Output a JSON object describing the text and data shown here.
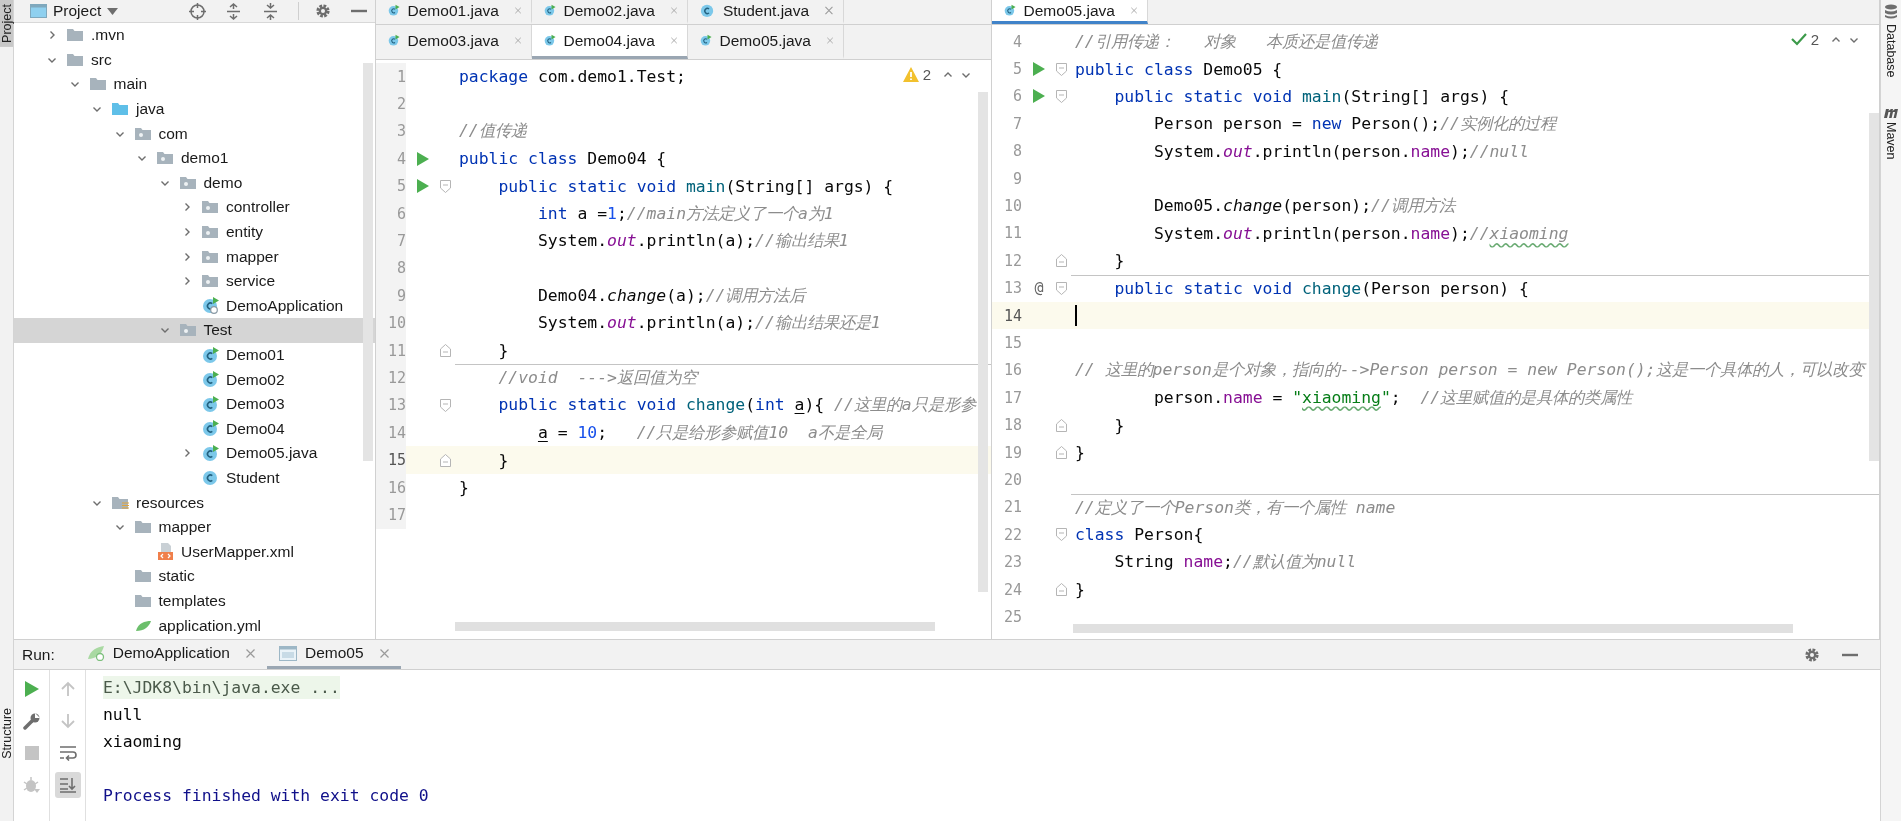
{
  "side_bar_left": {
    "top": [
      {
        "label": "Project",
        "selected": true
      }
    ],
    "bottom": [
      {
        "label": "Structure",
        "selected": false
      }
    ]
  },
  "project_panel": {
    "title": "Project",
    "tree": [
      {
        "label": ".mvn",
        "kind": "folder",
        "expanded": false,
        "selected": false
      },
      {
        "label": "src",
        "kind": "folder",
        "expanded": true,
        "selected": false,
        "children": [
          {
            "label": "main",
            "kind": "folder",
            "expanded": true,
            "selected": false,
            "children": [
              {
                "label": "java",
                "kind": "source-folder",
                "expanded": true,
                "selected": false,
                "children": [
                  {
                    "label": "com",
                    "kind": "package",
                    "expanded": true,
                    "selected": false,
                    "children": [
                      {
                        "label": "demo1",
                        "kind": "package",
                        "expanded": true,
                        "selected": false,
                        "children": [
                          {
                            "label": "demo",
                            "kind": "package",
                            "expanded": true,
                            "selected": false,
                            "children": [
                              {
                                "label": "controller",
                                "kind": "package",
                                "expanded": false,
                                "selected": false
                              },
                              {
                                "label": "entity",
                                "kind": "package",
                                "expanded": false,
                                "selected": false
                              },
                              {
                                "label": "mapper",
                                "kind": "package",
                                "expanded": false,
                                "selected": false
                              },
                              {
                                "label": "service",
                                "kind": "package",
                                "expanded": false,
                                "selected": false
                              },
                              {
                                "label": "DemoApplication",
                                "kind": "spring-class",
                                "selected": false
                              }
                            ]
                          },
                          {
                            "label": "Test",
                            "kind": "package",
                            "expanded": true,
                            "selected": true,
                            "children": [
                              {
                                "label": "Demo01",
                                "kind": "class-runnable",
                                "selected": false
                              },
                              {
                                "label": "Demo02",
                                "kind": "class-runnable",
                                "selected": false
                              },
                              {
                                "label": "Demo03",
                                "kind": "class-runnable",
                                "selected": false
                              },
                              {
                                "label": "Demo04",
                                "kind": "class-runnable",
                                "selected": false
                              },
                              {
                                "label": "Demo05.java",
                                "kind": "class-runnable",
                                "expanded": false,
                                "selected": false
                              },
                              {
                                "label": "Student",
                                "kind": "class",
                                "selected": false
                              }
                            ]
                          }
                        ]
                      }
                    ]
                  }
                ]
              },
              {
                "label": "resources",
                "kind": "resources-folder",
                "expanded": true,
                "selected": false,
                "children": [
                  {
                    "label": "mapper",
                    "kind": "folder",
                    "expanded": true,
                    "selected": false,
                    "children": [
                      {
                        "label": "UserMapper.xml",
                        "kind": "xml-file",
                        "selected": false
                      }
                    ]
                  },
                  {
                    "label": "static",
                    "kind": "folder",
                    "selected": false
                  },
                  {
                    "label": "templates",
                    "kind": "folder",
                    "selected": false
                  },
                  {
                    "label": "application.yml",
                    "kind": "yml-file",
                    "selected": false
                  }
                ]
              }
            ]
          }
        ]
      }
    ]
  },
  "left_editor": {
    "focused": false,
    "inspection": {
      "kind": "warning",
      "count": "2"
    },
    "tab_rows": [
      [
        {
          "label": "Demo01.java",
          "kind": "class-runnable",
          "selected": false
        },
        {
          "label": "Demo02.java",
          "kind": "class-runnable",
          "selected": false
        },
        {
          "label": "Student.java",
          "kind": "class",
          "selected": false
        }
      ],
      [
        {
          "label": "Demo03.java",
          "kind": "class-runnable",
          "selected": false
        },
        {
          "label": "Demo04.java",
          "kind": "class-runnable",
          "selected": true
        },
        {
          "label": "Demo05.java",
          "kind": "class-runnable",
          "selected": false
        }
      ]
    ],
    "lines": [
      {
        "number": "1",
        "current": false,
        "tokens": [
          {
            "kind": "keyword",
            "text": "package"
          },
          {
            "kind": "plain",
            "text": " com.demo1.Test;"
          }
        ]
      },
      {
        "number": "2",
        "current": false
      },
      {
        "number": "3",
        "current": false,
        "tokens": [
          {
            "kind": "comment",
            "text": "//值传递"
          }
        ]
      },
      {
        "number": "4",
        "current": false,
        "runnable": true,
        "tokens": [
          {
            "kind": "keyword",
            "text": "public class "
          },
          {
            "kind": "plain",
            "text": "Demo04 {"
          }
        ]
      },
      {
        "number": "5",
        "current": false,
        "runnable": true,
        "fold_start": true,
        "tokens": [
          {
            "kind": "keyword",
            "text": "    public static void "
          },
          {
            "kind": "decl",
            "text": "main"
          },
          {
            "kind": "plain",
            "text": "(String[] args) {"
          }
        ]
      },
      {
        "number": "6",
        "current": false,
        "tokens": [
          {
            "kind": "keyword",
            "text": "        int"
          },
          {
            "kind": "plain",
            "text": " a ="
          },
          {
            "kind": "number",
            "text": "1"
          },
          {
            "kind": "plain",
            "text": ";"
          },
          {
            "kind": "comment",
            "text": "//main方法定义了一个a为1"
          }
        ]
      },
      {
        "number": "7",
        "current": false,
        "tokens": [
          {
            "kind": "plain",
            "text": "        System."
          },
          {
            "kind": "static-field",
            "text": "out"
          },
          {
            "kind": "plain",
            "text": ".println(a);"
          },
          {
            "kind": "comment",
            "text": "//输出结果1"
          }
        ]
      },
      {
        "number": "8",
        "current": false
      },
      {
        "number": "9",
        "current": false,
        "tokens": [
          {
            "kind": "plain",
            "text": "        Demo04."
          },
          {
            "kind": "static-call",
            "text": "change"
          },
          {
            "kind": "plain",
            "text": "(a);"
          },
          {
            "kind": "comment",
            "text": "//调用方法后"
          }
        ]
      },
      {
        "number": "10",
        "current": false,
        "tokens": [
          {
            "kind": "plain",
            "text": "        System."
          },
          {
            "kind": "static-field",
            "text": "out"
          },
          {
            "kind": "plain",
            "text": ".println(a);"
          },
          {
            "kind": "comment",
            "text": "//输出结果还是1"
          }
        ]
      },
      {
        "number": "11",
        "current": false,
        "fold_end": true,
        "tokens": [
          {
            "kind": "plain",
            "text": "    }"
          }
        ]
      },
      {
        "number": "12",
        "current": false,
        "separator": true,
        "tokens": [
          {
            "kind": "comment",
            "text": "    //void  --->返回值为空"
          }
        ]
      },
      {
        "number": "13",
        "current": false,
        "fold_start": true,
        "tokens": [
          {
            "kind": "keyword",
            "text": "    public static void "
          },
          {
            "kind": "decl",
            "text": "change"
          },
          {
            "kind": "plain",
            "text": "("
          },
          {
            "kind": "keyword",
            "text": "int "
          },
          {
            "kind": "param",
            "text": "a"
          },
          {
            "kind": "plain",
            "text": "){ "
          },
          {
            "kind": "comment",
            "text": "//这里的a只是形参"
          }
        ]
      },
      {
        "number": "14",
        "current": false,
        "tokens": [
          {
            "kind": "param",
            "text": "        a"
          },
          {
            "kind": "plain",
            "text": " = "
          },
          {
            "kind": "number",
            "text": "10"
          },
          {
            "kind": "plain",
            "text": ";   "
          },
          {
            "kind": "comment",
            "text": "//只是给形参赋值10  a不是全局"
          }
        ]
      },
      {
        "number": "15",
        "current": true,
        "fold_end": true,
        "tokens": [
          {
            "kind": "plain",
            "text": "    }"
          }
        ]
      },
      {
        "number": "16",
        "current": false,
        "tokens": [
          {
            "kind": "plain",
            "text": "}"
          }
        ]
      },
      {
        "number": "17",
        "current": false
      }
    ]
  },
  "right_editor": {
    "focused": true,
    "inspection": {
      "kind": "ok",
      "count": "2"
    },
    "tab_rows": [
      [
        {
          "label": "Demo05.java",
          "kind": "class-runnable",
          "selected": true
        }
      ]
    ],
    "lines": [
      {
        "number": "4",
        "current": false,
        "tokens": [
          {
            "kind": "comment",
            "text": "//引用传递：   对象   本质还是值传递"
          }
        ]
      },
      {
        "number": "5",
        "current": false,
        "runnable": true,
        "fold_start": true,
        "tokens": [
          {
            "kind": "keyword",
            "text": "public class "
          },
          {
            "kind": "plain",
            "text": "Demo05 {"
          }
        ]
      },
      {
        "number": "6",
        "current": false,
        "runnable": true,
        "fold_start": true,
        "tokens": [
          {
            "kind": "keyword",
            "text": "    public static void "
          },
          {
            "kind": "decl",
            "text": "main"
          },
          {
            "kind": "plain",
            "text": "(String[] args) {"
          }
        ]
      },
      {
        "number": "7",
        "current": false,
        "tokens": [
          {
            "kind": "plain",
            "text": "        Person person = "
          },
          {
            "kind": "keyword",
            "text": "new"
          },
          {
            "kind": "plain",
            "text": " Person();"
          },
          {
            "kind": "comment",
            "text": "//实例化的过程"
          }
        ]
      },
      {
        "number": "8",
        "current": false,
        "tokens": [
          {
            "kind": "plain",
            "text": "        System."
          },
          {
            "kind": "static-field",
            "text": "out"
          },
          {
            "kind": "plain",
            "text": ".println(person."
          },
          {
            "kind": "field",
            "text": "name"
          },
          {
            "kind": "plain",
            "text": ");"
          },
          {
            "kind": "comment",
            "text": "//null"
          }
        ]
      },
      {
        "number": "9",
        "current": false
      },
      {
        "number": "10",
        "current": false,
        "tokens": [
          {
            "kind": "plain",
            "text": "        Demo05."
          },
          {
            "kind": "static-call",
            "text": "change"
          },
          {
            "kind": "plain",
            "text": "(person);"
          },
          {
            "kind": "comment",
            "text": "//调用方法"
          }
        ]
      },
      {
        "number": "11",
        "current": false,
        "tokens": [
          {
            "kind": "plain",
            "text": "        System."
          },
          {
            "kind": "static-field",
            "text": "out"
          },
          {
            "kind": "plain",
            "text": ".println(person."
          },
          {
            "kind": "field",
            "text": "name"
          },
          {
            "kind": "plain",
            "text": ");"
          },
          {
            "kind": "comment",
            "text": "//"
          },
          {
            "kind": "typo-comment",
            "text": "xiaoming"
          }
        ]
      },
      {
        "number": "12",
        "current": false,
        "fold_end": true,
        "tokens": [
          {
            "kind": "plain",
            "text": "    }"
          }
        ]
      },
      {
        "number": "13",
        "current": false,
        "gutter_text": "@",
        "fold_start": true,
        "separator": true,
        "tokens": [
          {
            "kind": "keyword",
            "text": "    public static void "
          },
          {
            "kind": "decl",
            "text": "change"
          },
          {
            "kind": "plain",
            "text": "(Person person) {"
          }
        ]
      },
      {
        "number": "14",
        "current": true
      },
      {
        "number": "15",
        "current": false
      },
      {
        "number": "16",
        "current": false,
        "tokens": [
          {
            "kind": "comment",
            "text": "// 这里的person是个对象，指向的-->Person person = new Person();这是一个具体的人，可以改变"
          }
        ]
      },
      {
        "number": "17",
        "current": false,
        "tokens": [
          {
            "kind": "plain",
            "text": "        person."
          },
          {
            "kind": "field",
            "text": "name"
          },
          {
            "kind": "plain",
            "text": " = "
          },
          {
            "kind": "string",
            "text": "\""
          },
          {
            "kind": "typo-string",
            "text": "xiaoming"
          },
          {
            "kind": "string",
            "text": "\""
          },
          {
            "kind": "plain",
            "text": ";  "
          },
          {
            "kind": "comment",
            "text": "//这里赋值的是具体的类属性"
          }
        ]
      },
      {
        "number": "18",
        "current": false,
        "fold_end": true,
        "tokens": [
          {
            "kind": "plain",
            "text": "    }"
          }
        ]
      },
      {
        "number": "19",
        "current": false,
        "fold_end": true,
        "tokens": [
          {
            "kind": "plain",
            "text": "}"
          }
        ]
      },
      {
        "number": "20",
        "current": false
      },
      {
        "number": "21",
        "current": false,
        "separator": true,
        "tokens": [
          {
            "kind": "comment",
            "text": "//定义了一个Person类，有一个属性 name"
          }
        ]
      },
      {
        "number": "22",
        "current": false,
        "fold_start": true,
        "tokens": [
          {
            "kind": "keyword",
            "text": "class "
          },
          {
            "kind": "plain",
            "text": "Person{"
          }
        ]
      },
      {
        "number": "23",
        "current": false,
        "tokens": [
          {
            "kind": "plain",
            "text": "    String "
          },
          {
            "kind": "field",
            "text": "name"
          },
          {
            "kind": "plain",
            "text": ";"
          },
          {
            "kind": "comment",
            "text": "//默认值为null"
          }
        ]
      },
      {
        "number": "24",
        "current": false,
        "fold_end": true,
        "tokens": [
          {
            "kind": "plain",
            "text": "}"
          }
        ]
      },
      {
        "number": "25",
        "current": false
      }
    ]
  },
  "run_panel": {
    "label": "Run:",
    "tabs": [
      {
        "label": "DemoApplication",
        "kind": "spring-run",
        "selected": false
      },
      {
        "label": "Demo05",
        "kind": "console",
        "selected": true
      }
    ],
    "left_tools": [
      {
        "kind": "rerun",
        "disabled": false
      },
      {
        "kind": "wrench",
        "disabled": false
      },
      {
        "kind": "stop",
        "disabled": true
      },
      {
        "kind": "debug",
        "disabled": true
      }
    ],
    "right_tools": [
      {
        "kind": "up",
        "disabled": true,
        "on": false
      },
      {
        "kind": "down",
        "disabled": true,
        "on": false
      },
      {
        "kind": "wrap",
        "disabled": false,
        "on": false
      },
      {
        "kind": "scroll-end",
        "disabled": false,
        "on": true
      }
    ],
    "console": [
      {
        "kind": "command",
        "text": "E:\\JDK8\\bin\\java.exe ..."
      },
      {
        "kind": "output",
        "text": "null"
      },
      {
        "kind": "output",
        "text": "xiaoming"
      },
      {
        "kind": "blank"
      },
      {
        "kind": "exit",
        "text": "Process finished with exit code 0"
      }
    ]
  },
  "side_bar_right": [
    {
      "label": "Database",
      "kind": "database"
    },
    {
      "label": "Maven",
      "kind": "maven"
    }
  ]
}
